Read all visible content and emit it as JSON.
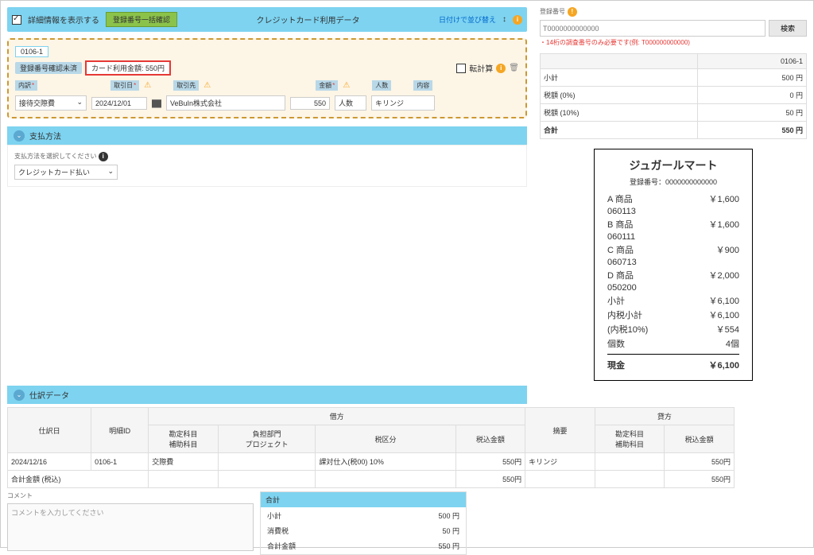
{
  "topbar": {
    "checkbox_label": "詳細情報を表示する",
    "bulk_confirm": "登録番号一括確認",
    "data_type": "クレジットカード利用データ",
    "sort_link": "日付けで並び替え",
    "info": "i"
  },
  "detail": {
    "id": "0106-1",
    "status_badge": "登録番号確認未済",
    "card_amount_badge": "カード利用金額: 550円",
    "transfer_checkbox": "転計算",
    "labels": {
      "category": "内訳",
      "date": "取引日",
      "partner": "取引先",
      "amount": "金額",
      "people": "人数",
      "note": "内容"
    },
    "values": {
      "category": "接待交際費",
      "date": "2024/12/01",
      "partner": "VeBuIn株式会社",
      "amount": "550",
      "people": "人数",
      "note": "キリンジ"
    }
  },
  "payment": {
    "header": "支払方法",
    "prompt": "支払方法を選択してください",
    "value": "クレジットカード払い"
  },
  "registration": {
    "label": "登録番号",
    "placeholder": "T0000000000000",
    "search_btn": "検索",
    "error": "・14桁の調査番号のみ必要です(例: T000000000000)"
  },
  "summary": {
    "col": "0106-1",
    "rows": {
      "subtotal_label": "小計",
      "subtotal_val": "500 円",
      "tax0_label": "税額 (0%)",
      "tax0_val": "0 円",
      "tax10_label": "税額 (10%)",
      "tax10_val": "50 円",
      "total_label": "合計",
      "total_val": "550 円"
    }
  },
  "receipt": {
    "title": "ジュガールマート",
    "reg": "登録番号：0000000000000",
    "items": [
      {
        "name": "A 商品",
        "price": "￥1,600"
      },
      {
        "code": "060113",
        "price": ""
      },
      {
        "name": "B 商品",
        "price": "￥1,600"
      },
      {
        "code": "060111",
        "price": ""
      },
      {
        "name": "C 商品",
        "price": "￥900"
      },
      {
        "code": "060713",
        "price": ""
      },
      {
        "name": "D 商品",
        "price": "￥2,000"
      },
      {
        "code": "050200",
        "price": ""
      }
    ],
    "subtotal_l": "小計",
    "subtotal_v": "￥6,100",
    "intax_l": "内税小計",
    "intax_v": "￥6,100",
    "tax10_l": "(内税10%)",
    "tax10_v": "￥554",
    "qty_l": "個数",
    "qty_v": "4個",
    "cash_l": "現金",
    "cash_v": "￥6,100"
  },
  "journal": {
    "header": "仕訳データ",
    "cols": {
      "date": "仕訳日",
      "id": "明細ID",
      "debit": "借方",
      "credit": "貸方",
      "acct": "勘定科目\n補助科目",
      "dept": "負担部門\nプロジェクト",
      "taxcat": "税区分",
      "taxamt": "税込金額",
      "summary": "摘要"
    },
    "row": {
      "date": "2024/12/16",
      "id": "0106-1",
      "acct": "交際費",
      "dept": "",
      "taxcat": "課対仕入(税00) 10%",
      "debit_amt": "550円",
      "summary": "キリンジ",
      "credit_amt": "550円"
    },
    "total_label": "合計金額 (税込)",
    "debit_total": "550円",
    "credit_total": "550円"
  },
  "comment": {
    "label": "コメント",
    "placeholder": "コメントを入力してください"
  },
  "totals": {
    "header": "合計",
    "subtotal_l": "小計",
    "subtotal_v": "500 円",
    "tax_l": "消費税",
    "tax_v": "50 円",
    "grand_l": "合計金額",
    "grand_v": "550 円"
  }
}
